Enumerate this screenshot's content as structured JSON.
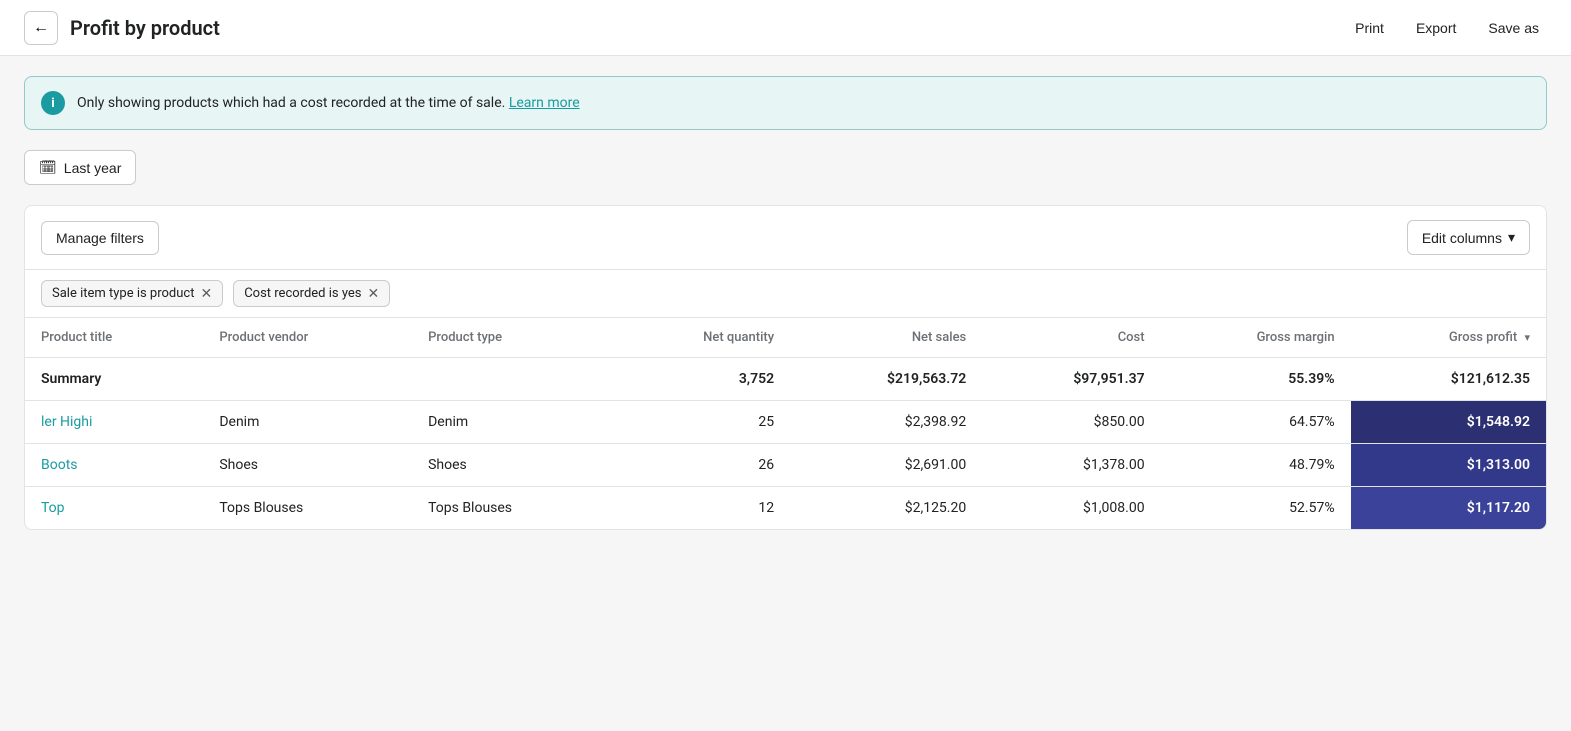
{
  "header": {
    "back_label": "←",
    "title": "Profit by product",
    "actions": {
      "print": "Print",
      "export": "Export",
      "save_as": "Save as"
    }
  },
  "info_banner": {
    "message": "Only showing products which had a cost recorded at the time of sale.",
    "link_text": "Learn more"
  },
  "date_filter": {
    "icon": "📅",
    "label": "Last year"
  },
  "table_toolbar": {
    "manage_filters": "Manage filters",
    "edit_columns": "Edit columns",
    "chevron": "▾"
  },
  "filters": [
    {
      "label": "Sale item type is product",
      "close": "✕"
    },
    {
      "label": "Cost recorded is yes",
      "close": "✕"
    }
  ],
  "table": {
    "columns": [
      {
        "key": "product_title",
        "label": "Product title",
        "align": "left"
      },
      {
        "key": "product_vendor",
        "label": "Product vendor",
        "align": "left"
      },
      {
        "key": "product_type",
        "label": "Product type",
        "align": "left"
      },
      {
        "key": "net_quantity",
        "label": "Net quantity",
        "align": "right"
      },
      {
        "key": "net_sales",
        "label": "Net sales",
        "align": "right"
      },
      {
        "key": "cost",
        "label": "Cost",
        "align": "right"
      },
      {
        "key": "gross_margin",
        "label": "Gross margin",
        "align": "right"
      },
      {
        "key": "gross_profit",
        "label": "Gross profit",
        "align": "right",
        "sortable": true
      }
    ],
    "summary": {
      "label": "Summary",
      "net_quantity": "3,752",
      "net_sales": "$219,563.72",
      "cost": "$97,951.37",
      "gross_margin": "55.39%",
      "gross_profit": "$121,612.35"
    },
    "rows": [
      {
        "product_title": "ler Highi",
        "product_vendor": "Denim",
        "product_type": "Denim",
        "net_quantity": "25",
        "net_sales": "$2,398.92",
        "cost": "$850.00",
        "gross_margin": "64.57%",
        "gross_profit": "$1,548.92"
      },
      {
        "product_title": "Boots",
        "product_vendor": "Shoes",
        "product_type": "Shoes",
        "net_quantity": "26",
        "net_sales": "$2,691.00",
        "cost": "$1,378.00",
        "gross_margin": "48.79%",
        "gross_profit": "$1,313.00"
      },
      {
        "product_title": "Top",
        "product_vendor": "Tops Blouses",
        "product_type": "Tops Blouses",
        "net_quantity": "12",
        "net_sales": "$2,125.20",
        "cost": "$1,008.00",
        "gross_margin": "52.57%",
        "gross_profit": "$1,117.20"
      }
    ]
  }
}
